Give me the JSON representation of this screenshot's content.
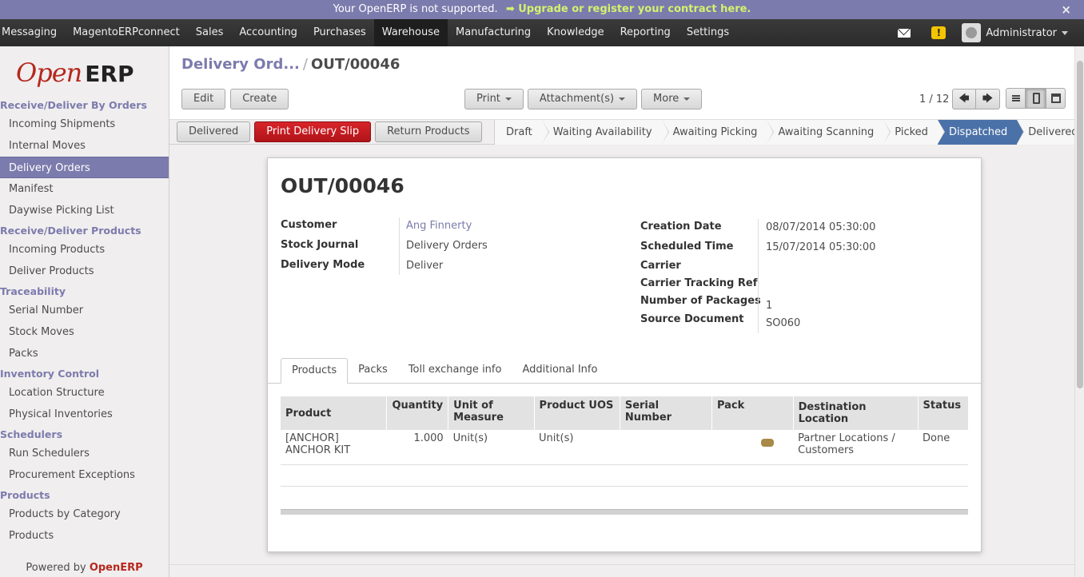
{
  "announcement": {
    "text": "Your OpenERP is not supported.",
    "link": "➡ Upgrade or register your contract here.",
    "close": "×"
  },
  "topmenu": {
    "items": [
      "Messaging",
      "MagentoERPconnect",
      "Sales",
      "Accounting",
      "Purchases",
      "Warehouse",
      "Manufacturing",
      "Knowledge",
      "Reporting",
      "Settings"
    ],
    "active": "Warehouse",
    "warning_glyph": "!",
    "user": "Administrator"
  },
  "sidebar": {
    "logo_open": "Open",
    "logo_erp": "ERP",
    "sections": [
      {
        "title": "Receive/Deliver By Orders",
        "items": [
          "Incoming Shipments",
          "Internal Moves",
          "Delivery Orders",
          "Manifest",
          "Daywise Picking List"
        ]
      },
      {
        "title": "Receive/Deliver Products",
        "items": [
          "Incoming Products",
          "Deliver Products"
        ]
      },
      {
        "title": "Traceability",
        "items": [
          "Serial Number",
          "Stock Moves",
          "Packs"
        ]
      },
      {
        "title": "Inventory Control",
        "items": [
          "Location Structure",
          "Physical Inventories"
        ]
      },
      {
        "title": "Schedulers",
        "items": [
          "Run Schedulers",
          "Procurement Exceptions"
        ]
      },
      {
        "title": "Products",
        "items": [
          "Products by Category",
          "Products"
        ]
      }
    ],
    "active_item": "Delivery Orders",
    "powered_by": "Powered by",
    "powered_brand": "OpenERP"
  },
  "header": {
    "breadcrumb_prev": "Delivery Ord...",
    "breadcrumb_sep": "/",
    "breadcrumb_current": "OUT/00046",
    "edit_label": "Edit",
    "create_label": "Create",
    "print_label": "Print",
    "attachment_label": "Attachment(s)",
    "more_label": "More",
    "pager": "1 / 12",
    "prev_glyph": "🡄",
    "next_glyph": "🡆"
  },
  "statusbar": {
    "buttons": [
      "Delivered",
      "Print Delivery Slip",
      "Return Products"
    ],
    "stages": [
      "Draft",
      "Waiting Availability",
      "Awaiting Picking",
      "Awaiting Scanning",
      "Picked",
      "Dispatched",
      "Delivered"
    ],
    "current_stage": "Dispatched"
  },
  "form": {
    "title": "OUT/00046",
    "left_fields": [
      {
        "label": "Customer",
        "value": "Ang Finnerty"
      },
      {
        "label": "Stock Journal",
        "value": "Delivery Orders"
      },
      {
        "label": "Delivery Mode",
        "value": "Deliver"
      }
    ],
    "right_fields": [
      {
        "label": "Creation Date",
        "value": "08/07/2014 05:30:00"
      },
      {
        "label": "Scheduled Time",
        "value": "15/07/2014 05:30:00"
      },
      {
        "label": "Carrier",
        "value": ""
      },
      {
        "label": "Carrier Tracking Ref",
        "value": ""
      },
      {
        "label": "Number of Packages",
        "value": "1"
      },
      {
        "label": "Source Document",
        "value": "SO060"
      }
    ],
    "tabs": [
      "Products",
      "Packs",
      "Toll exchange info",
      "Additional Info"
    ],
    "active_tab": "Products",
    "table": {
      "headers": [
        "Product",
        "Quantity",
        "Unit of Measure",
        "Product UOS",
        "Serial Number",
        "Pack",
        "Destination Location",
        "Status"
      ],
      "rows": [
        {
          "product": "[ANCHOR] ANCHOR KIT",
          "quantity": "1.000",
          "uom": "Unit(s)",
          "uos": "Unit(s)",
          "serial": "",
          "pack": "pack-icon",
          "destination": "Partner Locations / Customers",
          "status": "Done"
        }
      ]
    }
  },
  "colors": {
    "accent": "#7c7bad",
    "primary_button": "#c41d22",
    "current_stage": "#4b72a8",
    "link_green": "#d5f16d"
  }
}
